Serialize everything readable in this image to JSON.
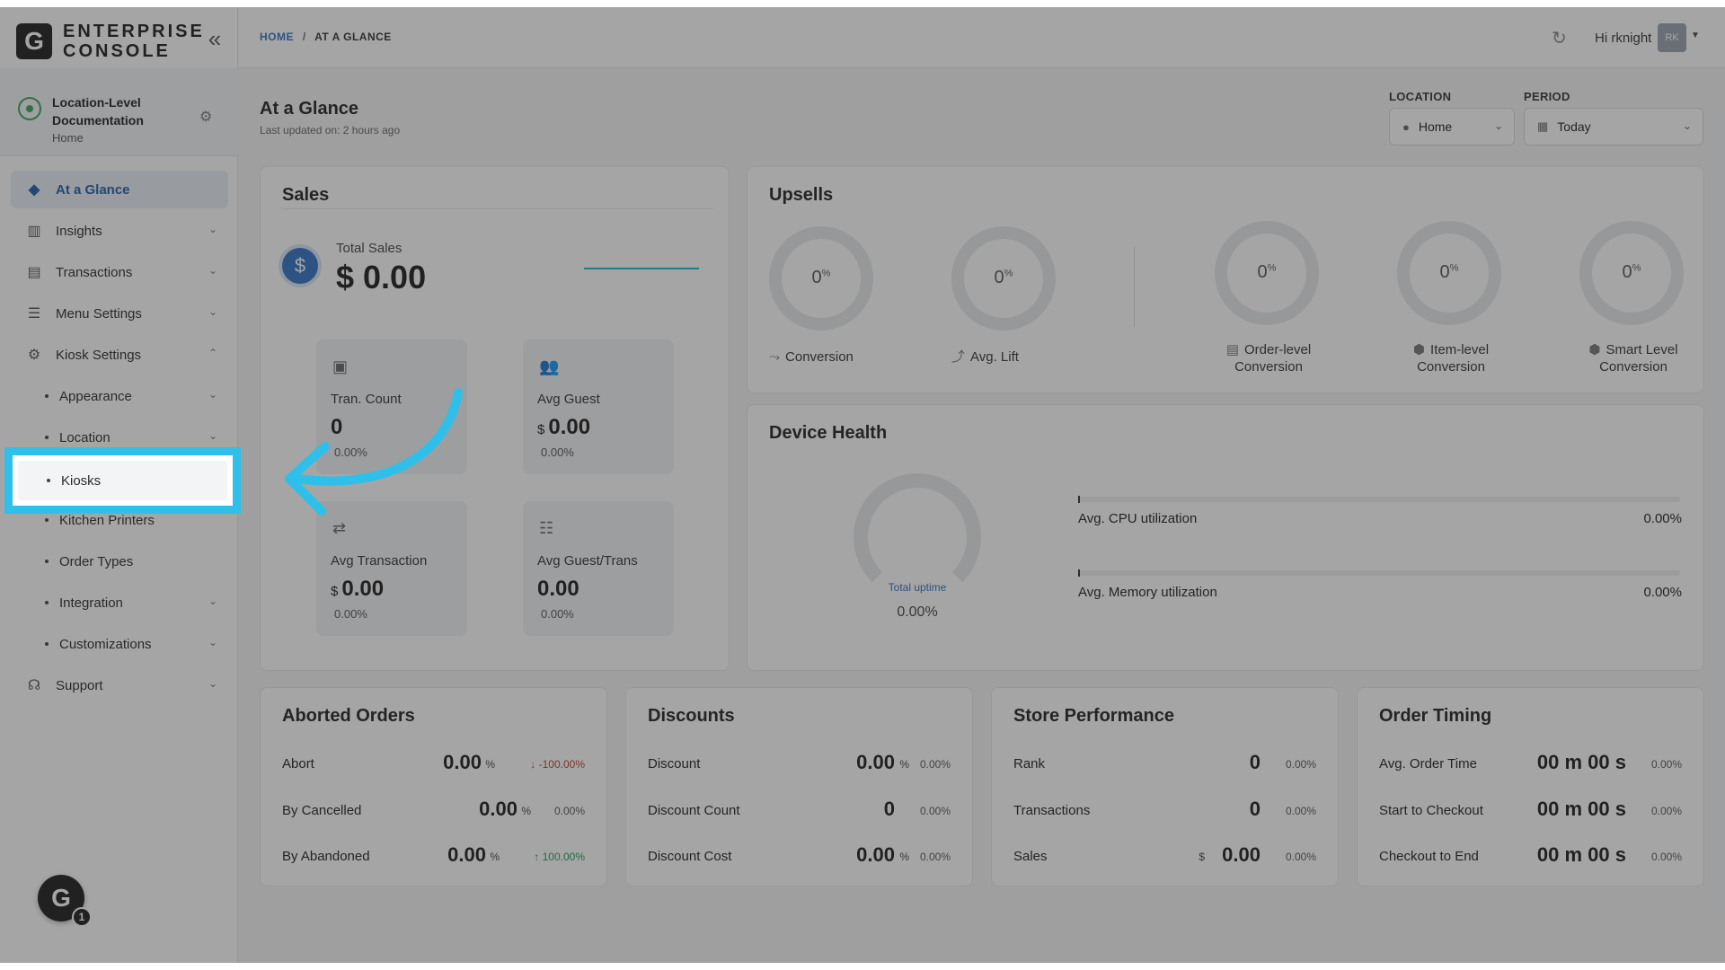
{
  "brand": {
    "logo_letter": "G",
    "line1": "ENTERPRISE",
    "line2": "CONSOLE"
  },
  "location_block": {
    "name": "Location-Level Documentation",
    "sub": "Home"
  },
  "nav": {
    "at_a_glance": "At a Glance",
    "insights": "Insights",
    "transactions": "Transactions",
    "menu_settings": "Menu Settings",
    "kiosk_settings": "Kiosk Settings",
    "appearance": "Appearance",
    "location": "Location",
    "kiosks": "Kiosks",
    "kitchen_printers": "Kitchen Printers",
    "order_types": "Order Types",
    "integration": "Integration",
    "customizations": "Customizations",
    "support": "Support"
  },
  "help": {
    "letter": "G",
    "badge": "1"
  },
  "breadcrumb": {
    "home": "HOME",
    "sep": "/",
    "current": "AT A GLANCE"
  },
  "user": {
    "greeting": "Hi rknight",
    "initials": "RK"
  },
  "page": {
    "title": "At a Glance",
    "updated": "Last updated on: 2 hours ago"
  },
  "filters": {
    "location_label": "LOCATION",
    "location_value": "Home",
    "period_label": "PERIOD",
    "period_value": "Today"
  },
  "sales": {
    "title": "Sales",
    "total_label": "Total Sales",
    "total_value": "$ 0.00",
    "tran_count": {
      "label": "Tran. Count",
      "value": "0",
      "pct": "0.00%"
    },
    "avg_guest": {
      "label": "Avg Guest",
      "currency": "$",
      "value": "0.00",
      "pct": "0.00%"
    },
    "avg_transaction": {
      "label": "Avg Transaction",
      "currency": "$",
      "value": "0.00",
      "pct": "0.00%"
    },
    "avg_guest_trans": {
      "label": "Avg Guest/Trans",
      "value": "0.00",
      "pct": "0.00%"
    }
  },
  "upsells": {
    "title": "Upsells",
    "pct_sign": "%",
    "items": [
      {
        "value": "0",
        "label": "Conversion"
      },
      {
        "value": "0",
        "label": "Avg. Lift"
      },
      {
        "value": "0",
        "label": "Order-level Conversion"
      },
      {
        "value": "0",
        "label": "Item-level Conversion"
      },
      {
        "value": "0",
        "label": "Smart Level Conversion"
      }
    ]
  },
  "device_health": {
    "title": "Device Health",
    "uptime_label": "Total uptime",
    "uptime_value": "0.00%",
    "cpu_label": "Avg. CPU utilization",
    "cpu_value": "0.00%",
    "mem_label": "Avg. Memory utilization",
    "mem_value": "0.00%"
  },
  "aborted": {
    "title": "Aborted Orders",
    "rows": [
      {
        "label": "Abort",
        "value": "0.00",
        "unit": "%",
        "pct": "↓ -100.00%"
      },
      {
        "label": "By Cancelled",
        "value": "0.00",
        "unit": "%",
        "pct": "0.00%"
      },
      {
        "label": "By Abandoned",
        "value": "0.00",
        "unit": "%",
        "pct": "↑ 100.00%"
      }
    ]
  },
  "discounts": {
    "title": "Discounts",
    "rows": [
      {
        "label": "Discount",
        "value": "0.00",
        "unit": "%",
        "pct": "0.00%"
      },
      {
        "label": "Discount Count",
        "value": "0",
        "pct": "0.00%"
      },
      {
        "label": "Discount Cost",
        "value": "0.00",
        "unit": "%",
        "pct": "0.00%"
      }
    ]
  },
  "store": {
    "title": "Store Performance",
    "rows": [
      {
        "label": "Rank",
        "value": "0",
        "pct": "0.00%"
      },
      {
        "label": "Transactions",
        "value": "0",
        "pct": "0.00%"
      },
      {
        "label": "Sales",
        "currency": "$",
        "value": "0.00",
        "pct": "0.00%"
      }
    ]
  },
  "timing": {
    "title": "Order Timing",
    "rows": [
      {
        "label": "Avg. Order Time",
        "value": "00 m 00 s",
        "pct": "0.00%"
      },
      {
        "label": "Start to Checkout",
        "value": "00 m 00 s",
        "pct": "0.00%"
      },
      {
        "label": "Checkout to End",
        "value": "00 m 00 s",
        "pct": "0.00%"
      }
    ]
  },
  "colors": {
    "accent": "#2f73c4",
    "highlight": "#2ec0ea",
    "negative": "#c0392b",
    "positive": "#1e9e5a"
  }
}
